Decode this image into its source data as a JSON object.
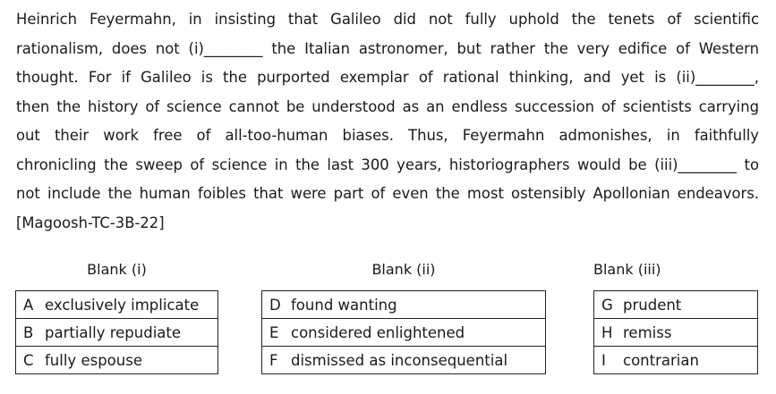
{
  "passage": {
    "lines": [
      "Heinrich Feyermahn, in insisting that Galileo did not fully uphold the tenets of scientific",
      "rationalism, does not (i)________ the Italian astronomer, but rather the very edifice of Western",
      "thought. For if Galileo is the purported exemplar of rational thinking, and yet is (ii)________,",
      "then the history of science cannot be understood as an endless succession of scientists carrying",
      "out their work free of all-too-human biases. Thus, Feyermahn admonishes, in faithfully",
      "chronicling the sweep of science in the last 300 years, historiographers would be (iii)________ to",
      "not include the human foibles that were part of even the most ostensibly Apollonian endeavors.",
      "[Magoosh-TC-3B-22]"
    ]
  },
  "blanks": [
    {
      "header": "Blank (i)",
      "options": [
        {
          "letter": "A",
          "text": "exclusively implicate"
        },
        {
          "letter": "B",
          "text": "partially repudiate"
        },
        {
          "letter": "C",
          "text": "fully espouse"
        }
      ]
    },
    {
      "header": "Blank (ii)",
      "options": [
        {
          "letter": "D",
          "text": "found wanting"
        },
        {
          "letter": "E",
          "text": "considered enlightened"
        },
        {
          "letter": "F",
          "text": "dismissed as inconsequential"
        }
      ]
    },
    {
      "header": "Blank (iii)",
      "options": [
        {
          "letter": "G",
          "text": "prudent"
        },
        {
          "letter": "H",
          "text": "remiss"
        },
        {
          "letter": "I",
          "text": "contrarian"
        }
      ]
    }
  ]
}
